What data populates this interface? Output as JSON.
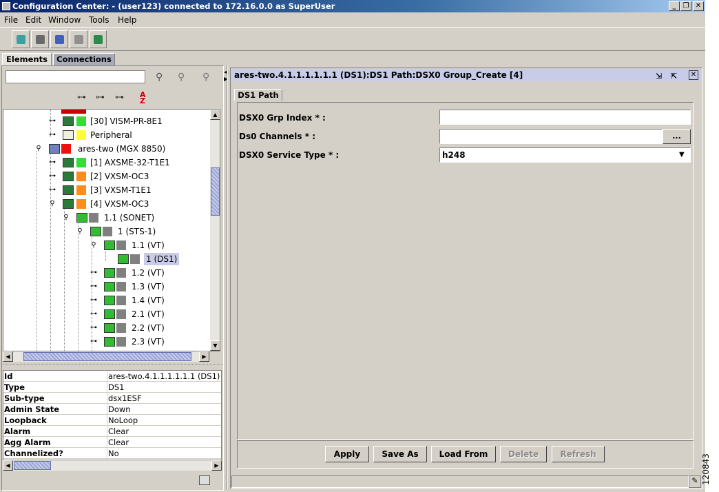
{
  "window": {
    "title": "Configuration Center: - (user123) connected to 172.16.0.0 as SuperUser"
  },
  "menu": [
    "File",
    "Edit",
    "Window",
    "Tools",
    "Help"
  ],
  "tabs": {
    "elements": "Elements",
    "connections": "Connections"
  },
  "tree": [
    {
      "label": "[30] VISM-PR-8E1",
      "color": "#33dd33"
    },
    {
      "label": "Peripheral",
      "color": "#ffff33"
    },
    {
      "label": "ares-two (MGX 8850)",
      "color": "#ee1111"
    },
    {
      "label": "[1] AXSME-32-T1E1",
      "color": "#33dd33"
    },
    {
      "label": "[2] VXSM-OC3",
      "color": "#ff8c1a"
    },
    {
      "label": "[3] VXSM-T1E1",
      "color": "#ff8c1a"
    },
    {
      "label": "[4] VXSM-OC3",
      "color": "#ff8c1a"
    },
    {
      "label": "1.1  (SONET)",
      "color": "#808080"
    },
    {
      "label": "1 (STS-1)",
      "color": "#808080"
    },
    {
      "label": "1.1 (VT)",
      "color": "#808080"
    },
    {
      "label": "1 (DS1)",
      "color": "#808080"
    },
    {
      "label": "1.2 (VT)",
      "color": "#808080"
    },
    {
      "label": "1.3 (VT)",
      "color": "#808080"
    },
    {
      "label": "1.4 (VT)",
      "color": "#808080"
    },
    {
      "label": "2.1 (VT)",
      "color": "#808080"
    },
    {
      "label": "2.2 (VT)",
      "color": "#808080"
    },
    {
      "label": "2.3 (VT)",
      "color": "#808080"
    }
  ],
  "properties": [
    {
      "key": "Id",
      "value": "ares-two.4.1.1.1.1.1.1 (DS1)"
    },
    {
      "key": "Type",
      "value": "DS1"
    },
    {
      "key": "Sub-type",
      "value": "dsx1ESF"
    },
    {
      "key": "Admin State",
      "value": "Down"
    },
    {
      "key": "Loopback",
      "value": "NoLoop"
    },
    {
      "key": "Alarm",
      "value": "Clear"
    },
    {
      "key": "Agg Alarm",
      "value": "Clear"
    },
    {
      "key": "Channelized?",
      "value": "No"
    }
  ],
  "panel": {
    "title": "ares-two.4.1.1.1.1.1.1 (DS1):DS1 Path:DSX0 Group_Create [4]",
    "tab": "DS1 Path"
  },
  "form": {
    "grp_index_label": "DSX0 Grp Index * :",
    "grp_index_value": "",
    "channels_label": "Ds0 Channels * :",
    "channels_value": "",
    "browse_label": "...",
    "service_type_label": "DSX0 Service Type * :",
    "service_type_value": "h248"
  },
  "buttons": {
    "apply": "Apply",
    "save_as": "Save As",
    "load_from": "Load From",
    "delete": "Delete",
    "refresh": "Refresh"
  },
  "figure_number": "120843"
}
